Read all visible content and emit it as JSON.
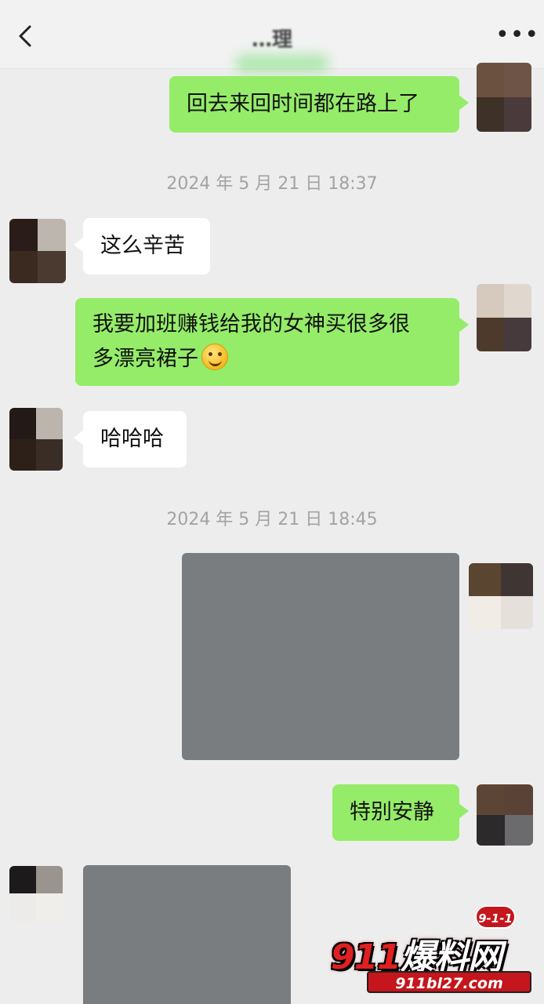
{
  "header": {
    "title": "…理",
    "back_icon": "chevron-left-icon",
    "more_label": "•••"
  },
  "messages": [
    {
      "type": "text",
      "direction": "out",
      "text": "回去来回时间都在路上了"
    },
    {
      "type": "timestamp",
      "text": "2024 年 5 月 21 日 18:37"
    },
    {
      "type": "text",
      "direction": "in",
      "text": "这么辛苦"
    },
    {
      "type": "text",
      "direction": "out",
      "line1": "我要加班赚钱给我的女神买很多很",
      "line2": "多漂亮裙子",
      "emoji": "smiley-icon"
    },
    {
      "type": "text",
      "direction": "in",
      "text": "哈哈哈"
    },
    {
      "type": "timestamp",
      "text": "2024 年 5 月 21 日 18:45"
    },
    {
      "type": "image",
      "direction": "out"
    },
    {
      "type": "text",
      "direction": "out",
      "text": "特别安静"
    },
    {
      "type": "image",
      "direction": "in"
    }
  ],
  "watermark": {
    "badge": "9-1-1",
    "main_number": "911",
    "main_text": "爆料网",
    "url": "911bl27.com"
  },
  "colors": {
    "outgoing_bubble": "#95ec69",
    "incoming_bubble": "#ffffff",
    "background": "#ededed",
    "image_placeholder": "#797d80"
  }
}
